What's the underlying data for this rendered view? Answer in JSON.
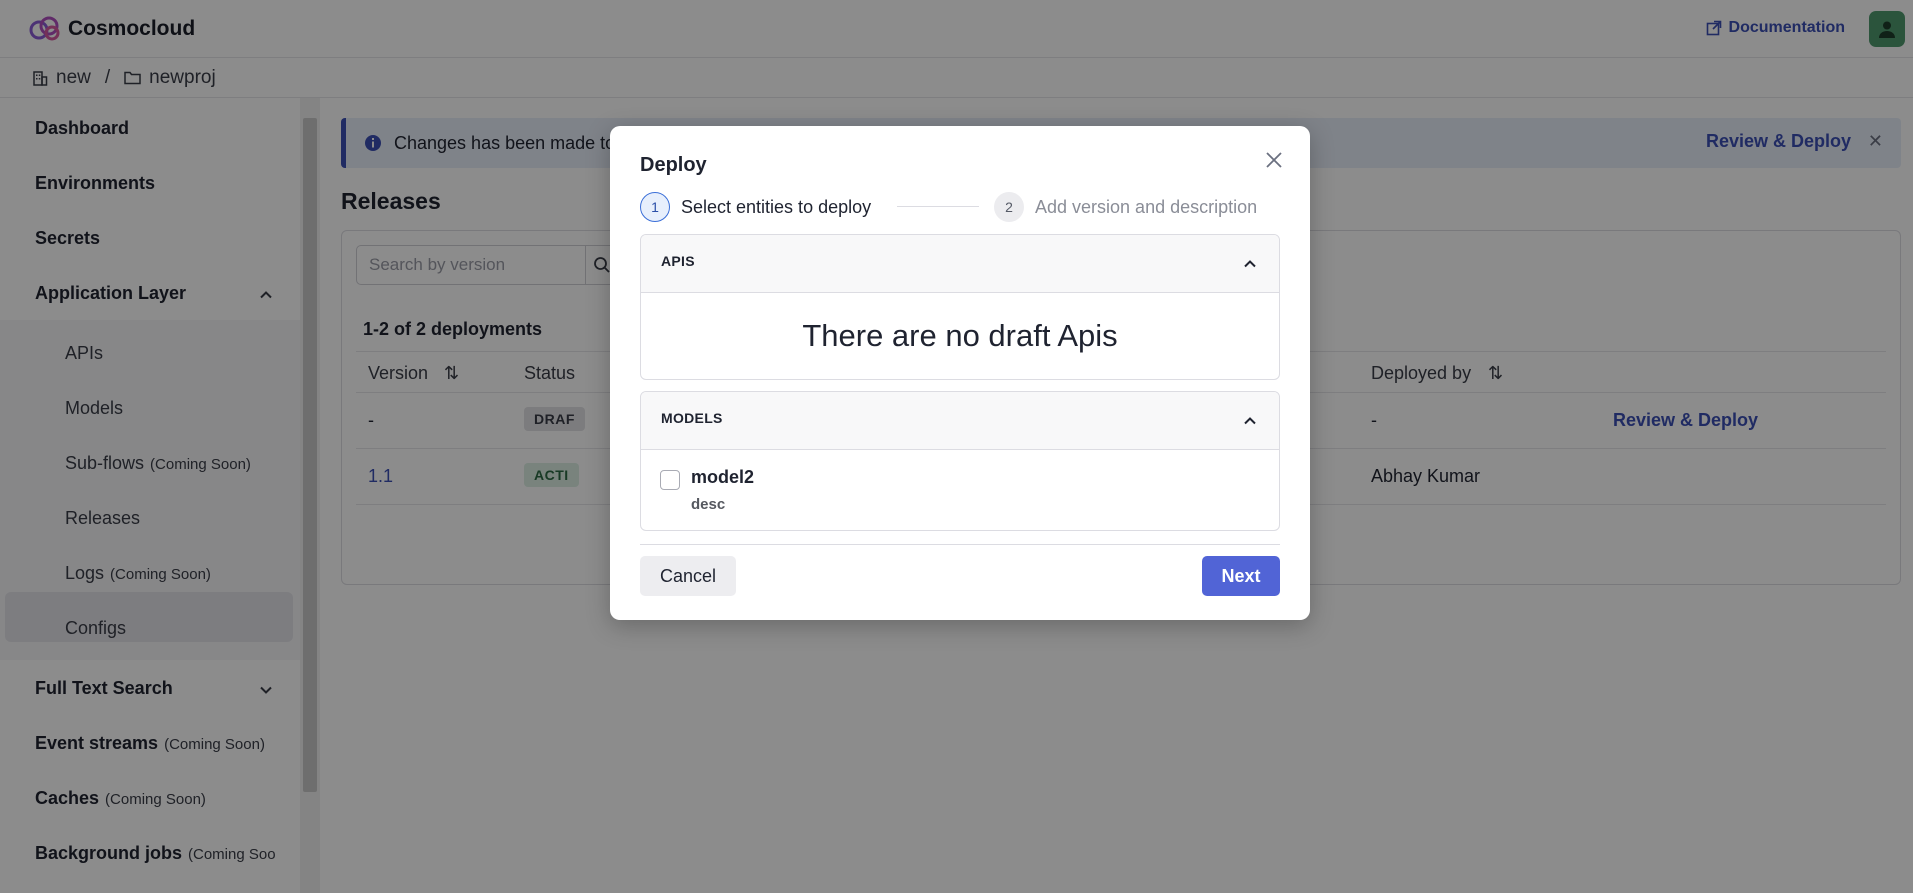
{
  "app": {
    "name": "Cosmocloud",
    "docs_label": "Documentation"
  },
  "breadcrumb": {
    "org": "new",
    "project": "newproj"
  },
  "sidebar": {
    "items": [
      {
        "label": "Dashboard"
      },
      {
        "label": "Environments"
      },
      {
        "label": "Secrets"
      },
      {
        "label": "Application Layer"
      }
    ],
    "sub_items": [
      {
        "label": "APIs"
      },
      {
        "label": "Models"
      },
      {
        "label": "Sub-flows",
        "soon": "(Coming Soon)"
      },
      {
        "label": "Releases"
      },
      {
        "label": "Logs",
        "soon": "(Coming Soon)"
      },
      {
        "label": "Configs"
      }
    ],
    "bottom_items": [
      {
        "label": "Full Text Search"
      },
      {
        "label": "Event streams",
        "soon": "(Coming Soon)"
      },
      {
        "label": "Caches",
        "soon": "(Coming Soon)"
      },
      {
        "label": "Background jobs",
        "soon": "(Coming Soo"
      }
    ]
  },
  "banner": {
    "text": "Changes has been made to",
    "link": "Review & Deploy"
  },
  "page": {
    "title": "Releases",
    "search_placeholder": "Search by version",
    "count": "1-2 of 2 deployments",
    "columns": {
      "version": "Version",
      "status": "Status",
      "deployed_by": "Deployed by"
    },
    "rows": [
      {
        "version": "-",
        "status": "DRAF",
        "deployed_by": "-",
        "action": "Review & Deploy"
      },
      {
        "version": "1.1",
        "status": "ACTI",
        "deployed_by": "Abhay Kumar",
        "action": ""
      }
    ]
  },
  "modal": {
    "title": "Deploy",
    "steps": [
      {
        "num": "1",
        "label": "Select entities to deploy"
      },
      {
        "num": "2",
        "label": "Add version and description"
      }
    ],
    "apis": {
      "title": "APIS",
      "empty": "There are no draft Apis"
    },
    "models": {
      "title": "MODELS",
      "items": [
        {
          "name": "model2",
          "desc": "desc"
        }
      ]
    },
    "cancel": "Cancel",
    "next": "Next"
  },
  "colors": {
    "accent": "#5164d6",
    "link": "#3b4fb5",
    "avatar": "#4f9a6e"
  }
}
